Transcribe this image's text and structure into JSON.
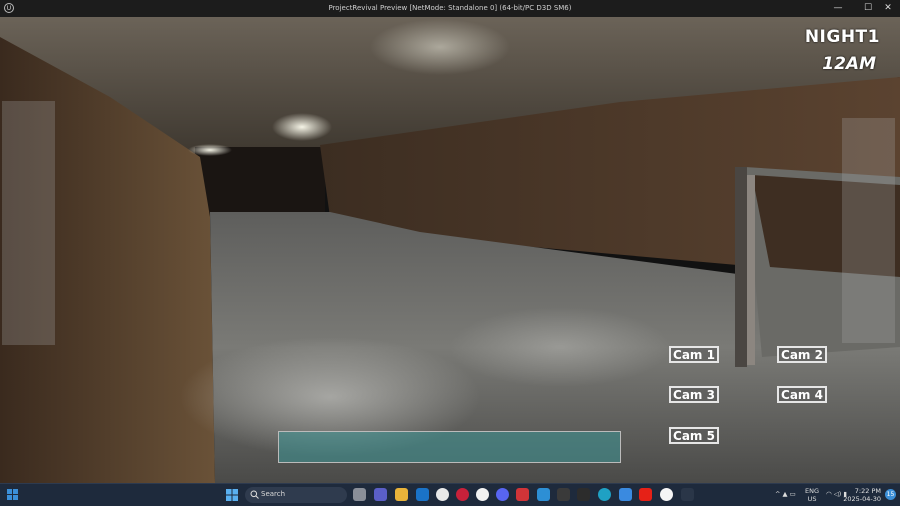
{
  "window": {
    "title": "ProjectRevival Preview [NetMode: Standalone 0]  (64-bit/PC D3D SM6)",
    "logo_text": "U",
    "minimize": "—",
    "maximize": "☐",
    "close": "✕"
  },
  "hud": {
    "night": "NIGHT1",
    "time": "12AM"
  },
  "cameras": [
    {
      "label": "Cam 1"
    },
    {
      "label": "Cam 2"
    },
    {
      "label": "Cam 3"
    },
    {
      "label": "Cam 4"
    },
    {
      "label": "Cam 5"
    }
  ],
  "taskbar": {
    "search_placeholder": "Search",
    "language": "ENG",
    "region": "US",
    "time": "7:22 PM",
    "date": "2025-04-30",
    "notifications": "15",
    "apps": [
      "file-explorer-icon",
      "teams-icon",
      "folder-icon",
      "outlook-icon",
      "chrome-icon",
      "opera-icon",
      "music-icon",
      "discord-icon",
      "app-red-icon",
      "photos-icon",
      "app-terminal-icon",
      "notion-icon",
      "edge-icon",
      "app-blue-icon",
      "youtube-icon",
      "unreal-icon",
      "app-bolt-icon"
    ]
  },
  "colors": {
    "accent": "#3b8fd8",
    "info_bar": "#3c9696",
    "taskbar": "#1e2a3c"
  }
}
